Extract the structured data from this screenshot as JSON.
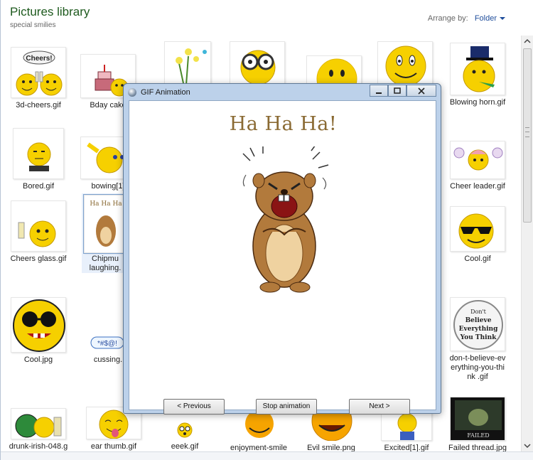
{
  "library": {
    "title": "Pictures library",
    "subtitle": "special smilies",
    "arrange_label": "Arrange by:",
    "arrange_value": "Folder"
  },
  "tiles": {
    "r1": [
      "3d-cheers.gif",
      "Bday cake",
      "Blowing horn.gif"
    ],
    "r2": [
      "Bored.gif",
      "bowing[1]",
      "Cheer leader.gif"
    ],
    "r3": [
      "Cheers glass.gif",
      "Chipmu",
      "laughing.",
      "Cool.gif"
    ],
    "r4": [
      "Cool.jpg",
      "cussing.",
      "don-t-believe-ev",
      "erything-you-thi",
      "nk .gif"
    ],
    "r5": [
      "drunk-irish-048.g",
      "ear thumb.gif",
      "eeek.gif",
      "enjoyment-smile",
      "Evil smile.png",
      "Excited[1].gif",
      "Failed thread.jpg"
    ]
  },
  "thumb_text": {
    "cheers_bubble": "Cheers!",
    "cussing": "*#$@!",
    "dont_believe": [
      "Don't",
      "Believe",
      "Everything",
      "You Think"
    ],
    "failed": "FAILED",
    "chip_mini": "Ha Ha Ha"
  },
  "dialog": {
    "title": "GIF Animation",
    "caption": "Ha Ha Ha!",
    "prev": "< Previous",
    "stop": "Stop animation",
    "next": "Next >"
  },
  "status": "",
  "colors": {
    "title_green": "#1e5a1e",
    "link_blue": "#1f4d9b",
    "dialog_frame": "#bcd1ea",
    "smiley_yellow": "#f6d000",
    "chipmunk_brown": "#b27a3c"
  }
}
